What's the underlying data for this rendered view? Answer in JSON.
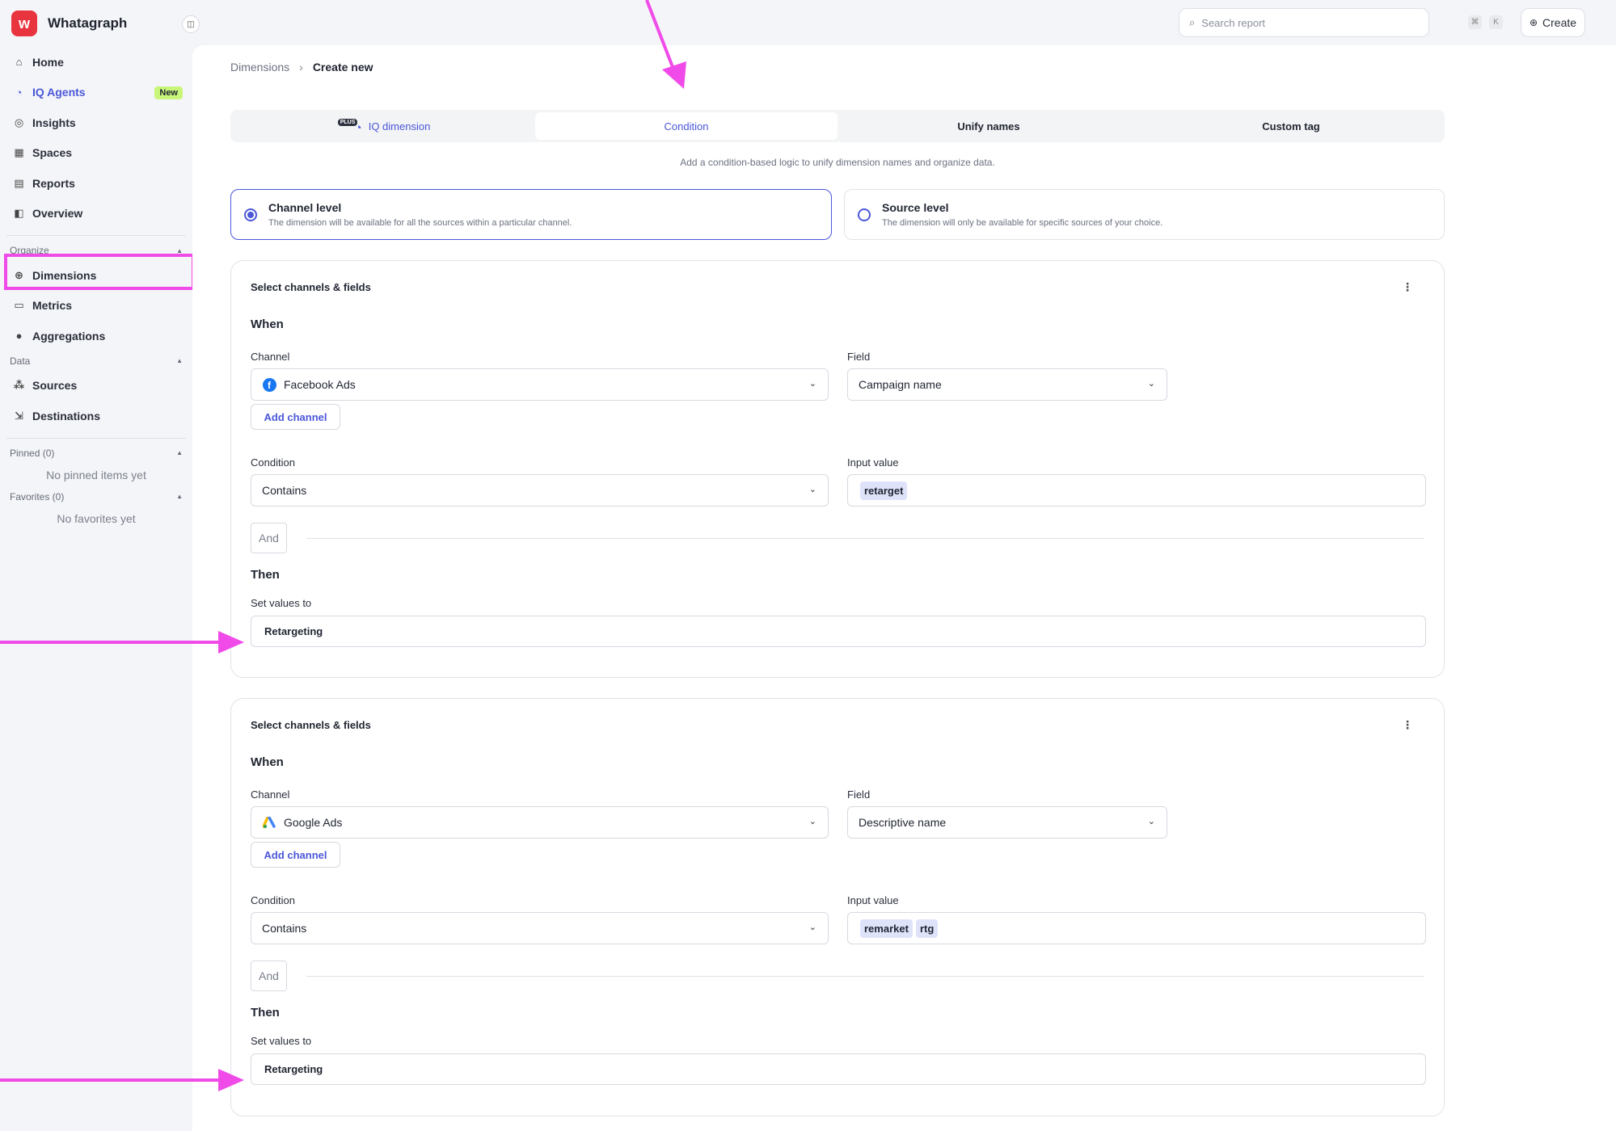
{
  "app": {
    "name": "Whatagraph",
    "logo_letter": "w"
  },
  "sidebar": {
    "items": [
      {
        "label": "Home",
        "icon": "home-icon"
      },
      {
        "label": "IQ Agents",
        "icon": "iq-icon",
        "badge": "New"
      },
      {
        "label": "Insights",
        "icon": "insights-icon"
      },
      {
        "label": "Spaces",
        "icon": "spaces-icon"
      },
      {
        "label": "Reports",
        "icon": "reports-icon"
      },
      {
        "label": "Overview",
        "icon": "overview-icon"
      }
    ],
    "organize": {
      "title": "Organize",
      "items": [
        {
          "label": "Dimensions",
          "icon": "dimensions-icon"
        },
        {
          "label": "Metrics",
          "icon": "metrics-icon"
        },
        {
          "label": "Aggregations",
          "icon": "aggregations-icon"
        }
      ]
    },
    "data_section": {
      "title": "Data",
      "items": [
        {
          "label": "Sources",
          "icon": "sources-icon"
        },
        {
          "label": "Destinations",
          "icon": "destinations-icon"
        }
      ]
    },
    "pinned": {
      "title": "Pinned (0)",
      "empty": "No pinned items yet"
    },
    "favorites": {
      "title": "Favorites (0)",
      "empty": "No favorites yet"
    }
  },
  "topbar": {
    "search_placeholder": "Search report",
    "shortcut_keys": [
      "⌘",
      "K"
    ],
    "create_label": "Create"
  },
  "breadcrumb": {
    "parent": "Dimensions",
    "current": "Create new"
  },
  "tabs": [
    {
      "label": "IQ dimension",
      "badge": "PLUS"
    },
    {
      "label": "Condition",
      "active": true
    },
    {
      "label": "Unify names"
    },
    {
      "label": "Custom tag"
    }
  ],
  "tabs_hint": "Add a condition-based logic to unify dimension names and organize data.",
  "levels": [
    {
      "title": "Channel level",
      "desc": "The dimension will be available for all the sources within a particular channel.",
      "selected": true
    },
    {
      "title": "Source level",
      "desc": "The dimension will only be available for specific sources of your choice.",
      "selected": false
    }
  ],
  "conditions": [
    {
      "header": "Select channels & fields",
      "when": "When",
      "channel_label": "Channel",
      "channel": "Facebook Ads",
      "field_label": "Field",
      "field": "Campaign name",
      "add_channel": "Add channel",
      "condition_label": "Condition",
      "condition": "Contains",
      "input_label": "Input value",
      "input_tags": [
        "retarget"
      ],
      "and_label": "And",
      "then": "Then",
      "set_values_label": "Set values to",
      "set_value": "Retargeting"
    },
    {
      "header": "Select channels & fields",
      "when": "When",
      "channel_label": "Channel",
      "channel": "Google Ads",
      "field_label": "Field",
      "field": "Descriptive name",
      "add_channel": "Add channel",
      "condition_label": "Condition",
      "condition": "Contains",
      "input_label": "Input value",
      "input_tags": [
        "remarket",
        "rtg"
      ],
      "and_label": "And",
      "then": "Then",
      "set_values_label": "Set values to",
      "set_value": "Retargeting"
    }
  ],
  "annotation_color": "#f04be8",
  "accent_color": "#4b57d8"
}
